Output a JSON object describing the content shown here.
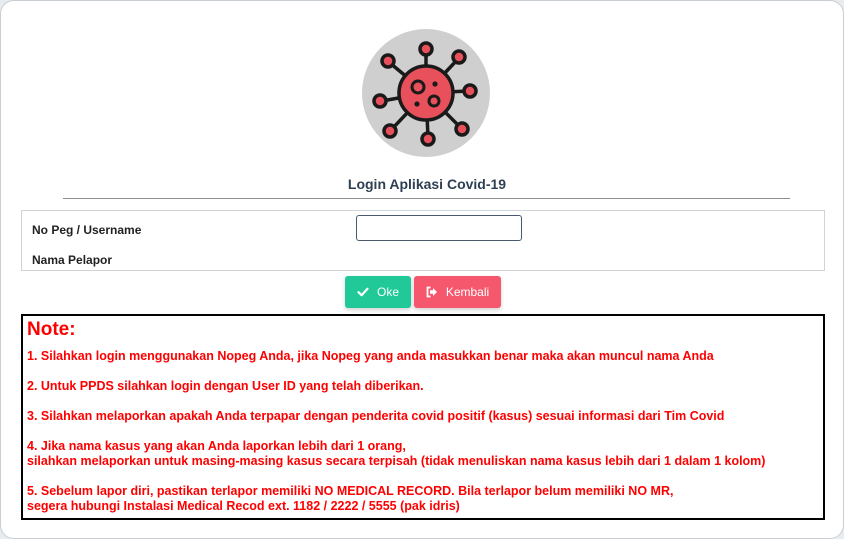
{
  "header": {
    "logo_icon": "virus-icon",
    "title": "Login Aplikasi Covid-19"
  },
  "form": {
    "username_label": "No Peg / Username",
    "username_value": "",
    "nama_label": "Nama Pelapor"
  },
  "buttons": {
    "ok_label": "Oke",
    "ok_icon": "check-icon",
    "ok_color": "#20c997",
    "back_label": "Kembali",
    "back_icon": "sign-out-icon",
    "back_color": "#f5576c"
  },
  "note": {
    "title": "Note:",
    "color": "#ff0000",
    "items": [
      [
        "1. Silahkan login menggunakan Nopeg Anda, jika Nopeg yang anda masukkan benar maka akan muncul nama Anda"
      ],
      [
        "2. Untuk PPDS silahkan login dengan User ID yang telah diberikan."
      ],
      [
        "3. Silahkan melaporkan apakah Anda terpapar dengan penderita covid positif (kasus) sesuai informasi dari Tim Covid"
      ],
      [
        "4. Jika nama kasus yang akan Anda laporkan lebih dari 1 orang,",
        "silahkan melaporkan untuk masing-masing kasus secara terpisah (tidak menuliskan nama kasus lebih dari 1 dalam 1 kolom)"
      ],
      [
        "5. Sebelum lapor diri, pastikan terlapor memiliki NO MEDICAL RECORD. Bila terlapor belum memiliki NO MR,",
        "segera hubungi Instalasi Medical Recod ext. 1182 / 2222 / 5555 (pak idris)"
      ]
    ]
  }
}
